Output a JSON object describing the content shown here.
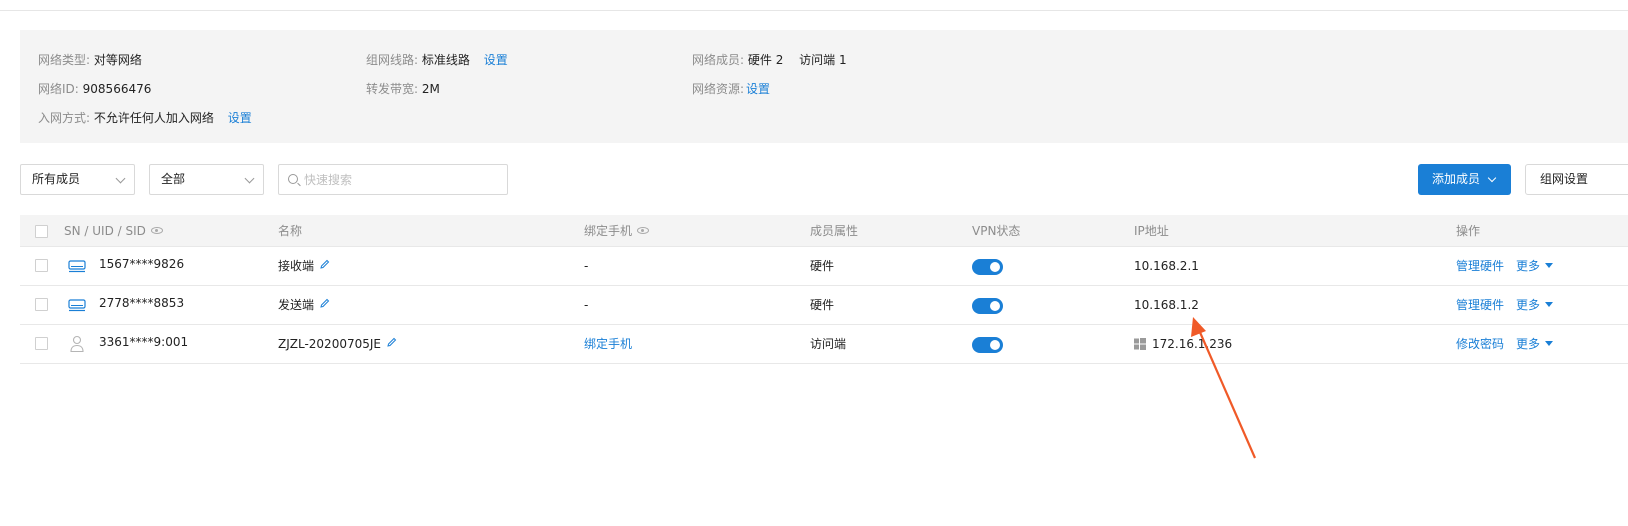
{
  "info": {
    "network_type_label": "网络类型:",
    "network_type_value": "对等网络",
    "network_id_label": "网络ID:",
    "network_id_value": "908566476",
    "join_method_label": "入网方式:",
    "join_method_value": "不允许任何人加入网络",
    "route_label": "组网线路:",
    "route_value": "标准线路",
    "bandwidth_label": "转发带宽:",
    "bandwidth_value": "2M",
    "members_label": "网络成员:",
    "members_hardware": "硬件 2",
    "members_visitor": "访问端 1",
    "resources_label": "网络资源:",
    "settings_link": "设置"
  },
  "toolbar": {
    "member_filter": "所有成员",
    "status_filter": "全部",
    "search_placeholder": "快速搜索",
    "add_member_label": "添加成员",
    "network_button_label": "组网设置"
  },
  "table": {
    "headers": {
      "sn": "SN / UID / SID",
      "name": "名称",
      "phone": "绑定手机",
      "member_attr": "成员属性",
      "vpn_status": "VPN状态",
      "ip": "IP地址",
      "actions": "操作"
    },
    "rows": [
      {
        "icon": "device-icon",
        "sn": "1567****9826",
        "name": "接收端",
        "phone": "-",
        "phone_is_link": false,
        "attr": "硬件",
        "vpn_on": true,
        "os_icon": "",
        "ip": "10.168.2.1",
        "action": "管理硬件",
        "more": "更多"
      },
      {
        "icon": "device-icon",
        "sn": "2778****8853",
        "name": "发送端",
        "phone": "-",
        "phone_is_link": false,
        "attr": "硬件",
        "vpn_on": true,
        "os_icon": "",
        "ip": "10.168.1.2",
        "action": "管理硬件",
        "more": "更多"
      },
      {
        "icon": "user-icon",
        "sn": "3361****9:001",
        "name": "ZJZL-20200705JE",
        "phone": "绑定手机",
        "phone_is_link": true,
        "attr": "访问端",
        "vpn_on": true,
        "os_icon": "windows-icon",
        "ip": "172.16.1.236",
        "action": "修改密码",
        "more": "更多"
      }
    ]
  },
  "colors": {
    "accent": "#1a7fd6",
    "annotation_arrow": "#f05a28",
    "panel_bg": "#f4f4f4"
  }
}
